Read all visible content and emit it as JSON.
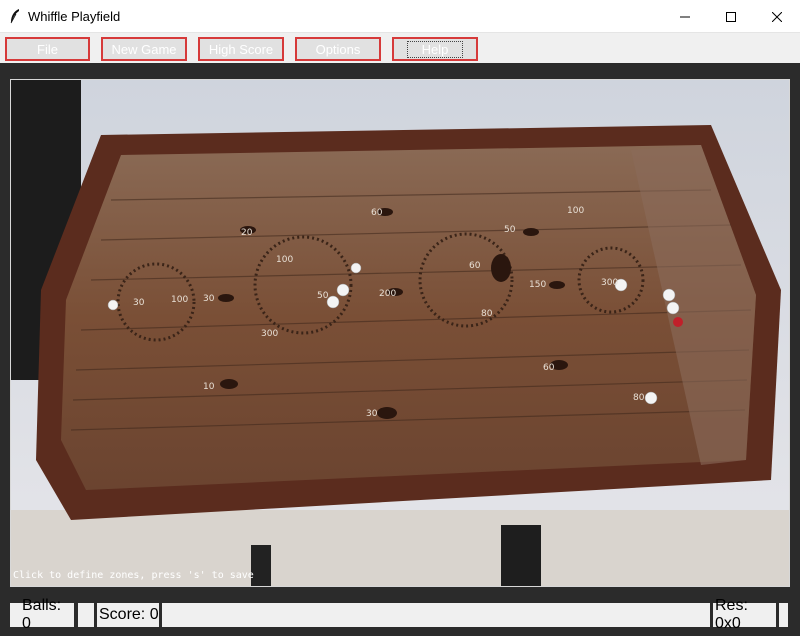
{
  "window": {
    "title": "Whiffle Playfield",
    "icon": "feather-icon",
    "controls": [
      "minimize-icon",
      "maximize-icon",
      "close-icon"
    ]
  },
  "menu": {
    "items": [
      "File",
      "New Game",
      "High Score",
      "Options",
      "Help"
    ]
  },
  "playfield": {
    "hint": "Click to define zones, press 's' to save",
    "score_labels": [
      "20",
      "60",
      "100",
      "50",
      "100",
      "50",
      "30",
      "100",
      "30",
      "300",
      "200",
      "60",
      "80",
      "150",
      "300",
      "10",
      "60",
      "30",
      "80"
    ]
  },
  "status": {
    "balls": "Balls: 0",
    "score": "Score: 0",
    "res": "Res: 0x0"
  },
  "colors": {
    "menu_border": "#d63a3a",
    "background": "#2b2b2b"
  }
}
